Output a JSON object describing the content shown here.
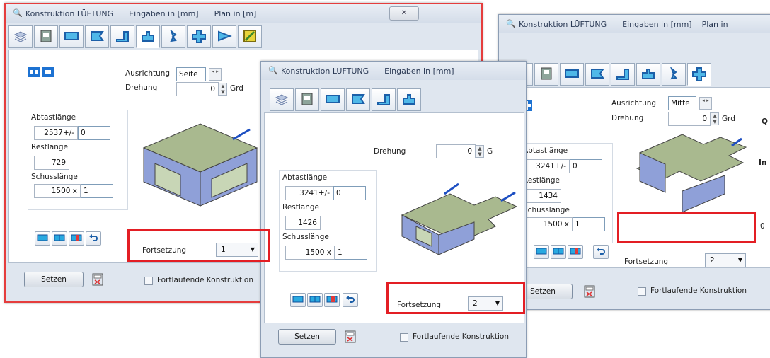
{
  "colors": {
    "accent": "#1f6fd1",
    "highlight": "#e31e24",
    "duct": "#a9b98f",
    "ductside": "#8fa0d8"
  },
  "windows": [
    {
      "title": "Konstruktion LÜFTUNG",
      "units": "Eingaben in [mm]",
      "plan": "Plan in  [m]",
      "close": "✕",
      "ausrichtung_label": "Ausrichtung",
      "ausrichtung_value": "Seite",
      "drehung_label": "Drehung",
      "drehung_value": "0",
      "drehung_unit": "Grd",
      "abtastlaenge_label": "Abtastlänge",
      "abtastlaenge_value": "2537",
      "tolerance_label": "+/-",
      "tolerance_value": "0",
      "restlaenge_label": "Restlänge",
      "restlaenge_value": "729",
      "schusslaenge_label": "Schusslänge",
      "schusslaenge_value": "1500",
      "times": "x",
      "count_value": "1",
      "fortsetzung_label": "Fortsetzung",
      "fortsetzung_value": "1",
      "setzen_label": "Setzen",
      "fortlaufende_label": "Fortlaufende Konstruktion"
    },
    {
      "title": "Konstruktion LÜFTUNG",
      "units": "Eingaben in [mm]",
      "drehung_label": "Drehung",
      "drehung_value": "0",
      "drehung_unit": "G",
      "abtastlaenge_label": "Abtastlänge",
      "abtastlaenge_value": "3241",
      "tolerance_label": "+/-",
      "tolerance_value": "0",
      "restlaenge_label": "Restlänge",
      "restlaenge_value": "1426",
      "schusslaenge_label": "Schusslänge",
      "schusslaenge_value": "1500",
      "times": "x",
      "count_value": "1",
      "fortsetzung_label": "Fortsetzung",
      "fortsetzung_value": "2",
      "setzen_label": "Setzen",
      "fortlaufende_label": "Fortlaufende Konstruktion"
    },
    {
      "title": "Konstruktion LÜFTUNG",
      "units": "Eingaben in [mm]",
      "plan": "Plan in",
      "ausrichtung_label": "Ausrichtung",
      "ausrichtung_value": "Mitte",
      "drehung_label": "Drehung",
      "drehung_value": "0",
      "drehung_unit": "Grd",
      "abtastlaenge_label": "Abtastlänge",
      "abtastlaenge_value": "3241",
      "tolerance_label": "+/-",
      "tolerance_value": "0",
      "restlaenge_label": "Restlänge",
      "restlaenge_value": "1434",
      "schusslaenge_label": "Schusslänge",
      "schusslaenge_value": "1500",
      "times": "x",
      "count_value": "1",
      "fortsetzung_label": "Fortsetzung",
      "fortsetzung_value": "2",
      "setzen_label": "Setzen",
      "fortlaufende_label": "Fortlaufende Konstruktion",
      "side_label_q": "Q",
      "side_label_in": "In",
      "side_label_0": "0"
    }
  ]
}
